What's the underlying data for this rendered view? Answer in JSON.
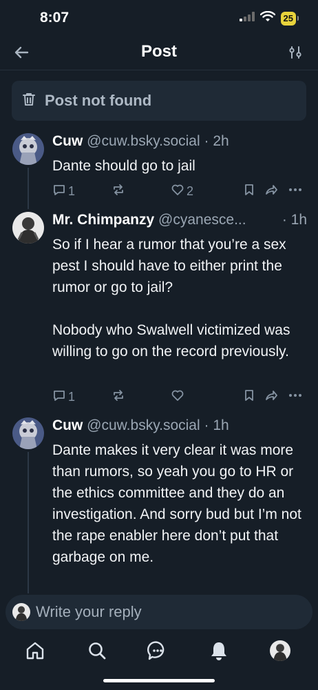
{
  "status": {
    "time": "8:07",
    "battery": "25"
  },
  "header": {
    "title": "Post"
  },
  "notice": {
    "text": "Post not found"
  },
  "posts": [
    {
      "name": "Cuw",
      "handle": "@cuw.bsky.social",
      "time": "· 2h",
      "text": "Dante should go to jail",
      "replies": "1",
      "reposts": "",
      "likes": "2"
    },
    {
      "name": "Mr. Chimpanzy",
      "handle": "@cyanesce...",
      "time": "· 1h",
      "text": "So if I hear a rumor that you’re a sex pest I should have to either print the rumor or go to jail?\n\nNobody who Swalwell  victimized was willing to go on the record previously.",
      "replies": "1",
      "reposts": "",
      "likes": ""
    },
    {
      "name": "Cuw",
      "handle": "@cuw.bsky.social",
      "time": "· 1h",
      "text": "Dante makes it very clear it was more than rumors, so yeah you go to HR or the ethics committee and they do an investigation. And sorry bud but I’m not the rape enabler here don’t put that garbage on me.",
      "replies": "",
      "reposts": "",
      "likes": ""
    }
  ],
  "reply": {
    "placeholder": "Write your reply"
  },
  "tabs": [
    "home-icon",
    "search-icon",
    "chat-icon",
    "notifications-icon",
    "profile-avatar"
  ]
}
